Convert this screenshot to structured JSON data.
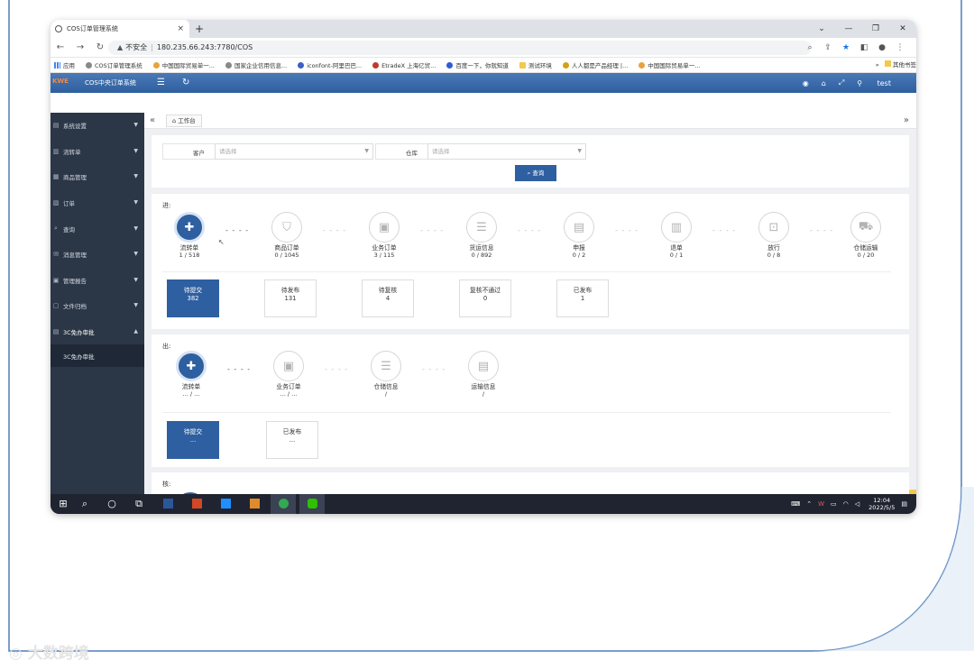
{
  "browser": {
    "tab_title": "COS订单管理系统",
    "tab_close": "×",
    "new_tab": "+",
    "security": "不安全",
    "url": "180.235.66.243:7780/COS",
    "bookmarks": [
      "应用",
      "COS订单管理系统",
      "中国国际贸易单一...",
      "国家企业信用信息...",
      "iconfont-阿里巴巴...",
      "EtradeX 上海亿贸...",
      "百度一下，你就知道",
      "测试环境",
      "人人都是产品经理 |...",
      "中国国际贸易单一..."
    ],
    "bookmarks_more": "»",
    "bookmarks_other": "其他书签"
  },
  "app": {
    "logo": "KWE",
    "title": "COS中央订单系统",
    "user": "test"
  },
  "sidebar": {
    "items": [
      {
        "label": "系统设置"
      },
      {
        "label": "流转单"
      },
      {
        "label": "商品管理"
      },
      {
        "label": "订单"
      },
      {
        "label": "查询"
      },
      {
        "label": "消息管理"
      },
      {
        "label": "管理报告"
      },
      {
        "label": "文件归档"
      },
      {
        "label": "3C免办审批"
      }
    ],
    "sub_item": "3C免办审批"
  },
  "tabs": {
    "workbench": "工作台"
  },
  "filter": {
    "customer_label": "客户",
    "customer_placeholder": "请选择",
    "warehouse_label": "仓库",
    "warehouse_placeholder": "请选择",
    "query_button": "查询"
  },
  "in_panel": {
    "title": "进:",
    "steps": [
      {
        "label": "流转单",
        "count": "1 / 518"
      },
      {
        "label": "商品订单",
        "count": "0 / 1045"
      },
      {
        "label": "业务订单",
        "count": "3 / 115"
      },
      {
        "label": "货运信息",
        "count": "0 / 892"
      },
      {
        "label": "申报",
        "count": "0 / 2"
      },
      {
        "label": "退单",
        "count": "0 / 1"
      },
      {
        "label": "放行",
        "count": "0 / 8"
      },
      {
        "label": "仓储运输",
        "count": "0 / 20"
      }
    ],
    "statuses": [
      {
        "label": "待提交",
        "value": "382"
      },
      {
        "label": "待发布",
        "value": "131"
      },
      {
        "label": "待复核",
        "value": "4"
      },
      {
        "label": "复核不通过",
        "value": "0"
      },
      {
        "label": "已发布",
        "value": "1"
      }
    ]
  },
  "out_panel": {
    "title": "出:",
    "steps": [
      {
        "label": "流转单",
        "count": "... / ..."
      },
      {
        "label": "业务订单",
        "count": "... / ..."
      },
      {
        "label": "仓储信息",
        "count": "/"
      },
      {
        "label": "运输信息",
        "count": "/"
      }
    ],
    "statuses": [
      {
        "label": "待提交",
        "value": "..."
      },
      {
        "label": "已发布",
        "value": "..."
      }
    ]
  },
  "third_panel": {
    "title": "核:"
  },
  "taskbar": {
    "time": "12:04",
    "date": "2022/5/5"
  },
  "watermark": "大数跨境",
  "colors": {
    "primary": "#2e5fa0",
    "sidebar": "#2b3646",
    "taskbar": "#1f2430",
    "frame_line": "#4f7fb8"
  }
}
